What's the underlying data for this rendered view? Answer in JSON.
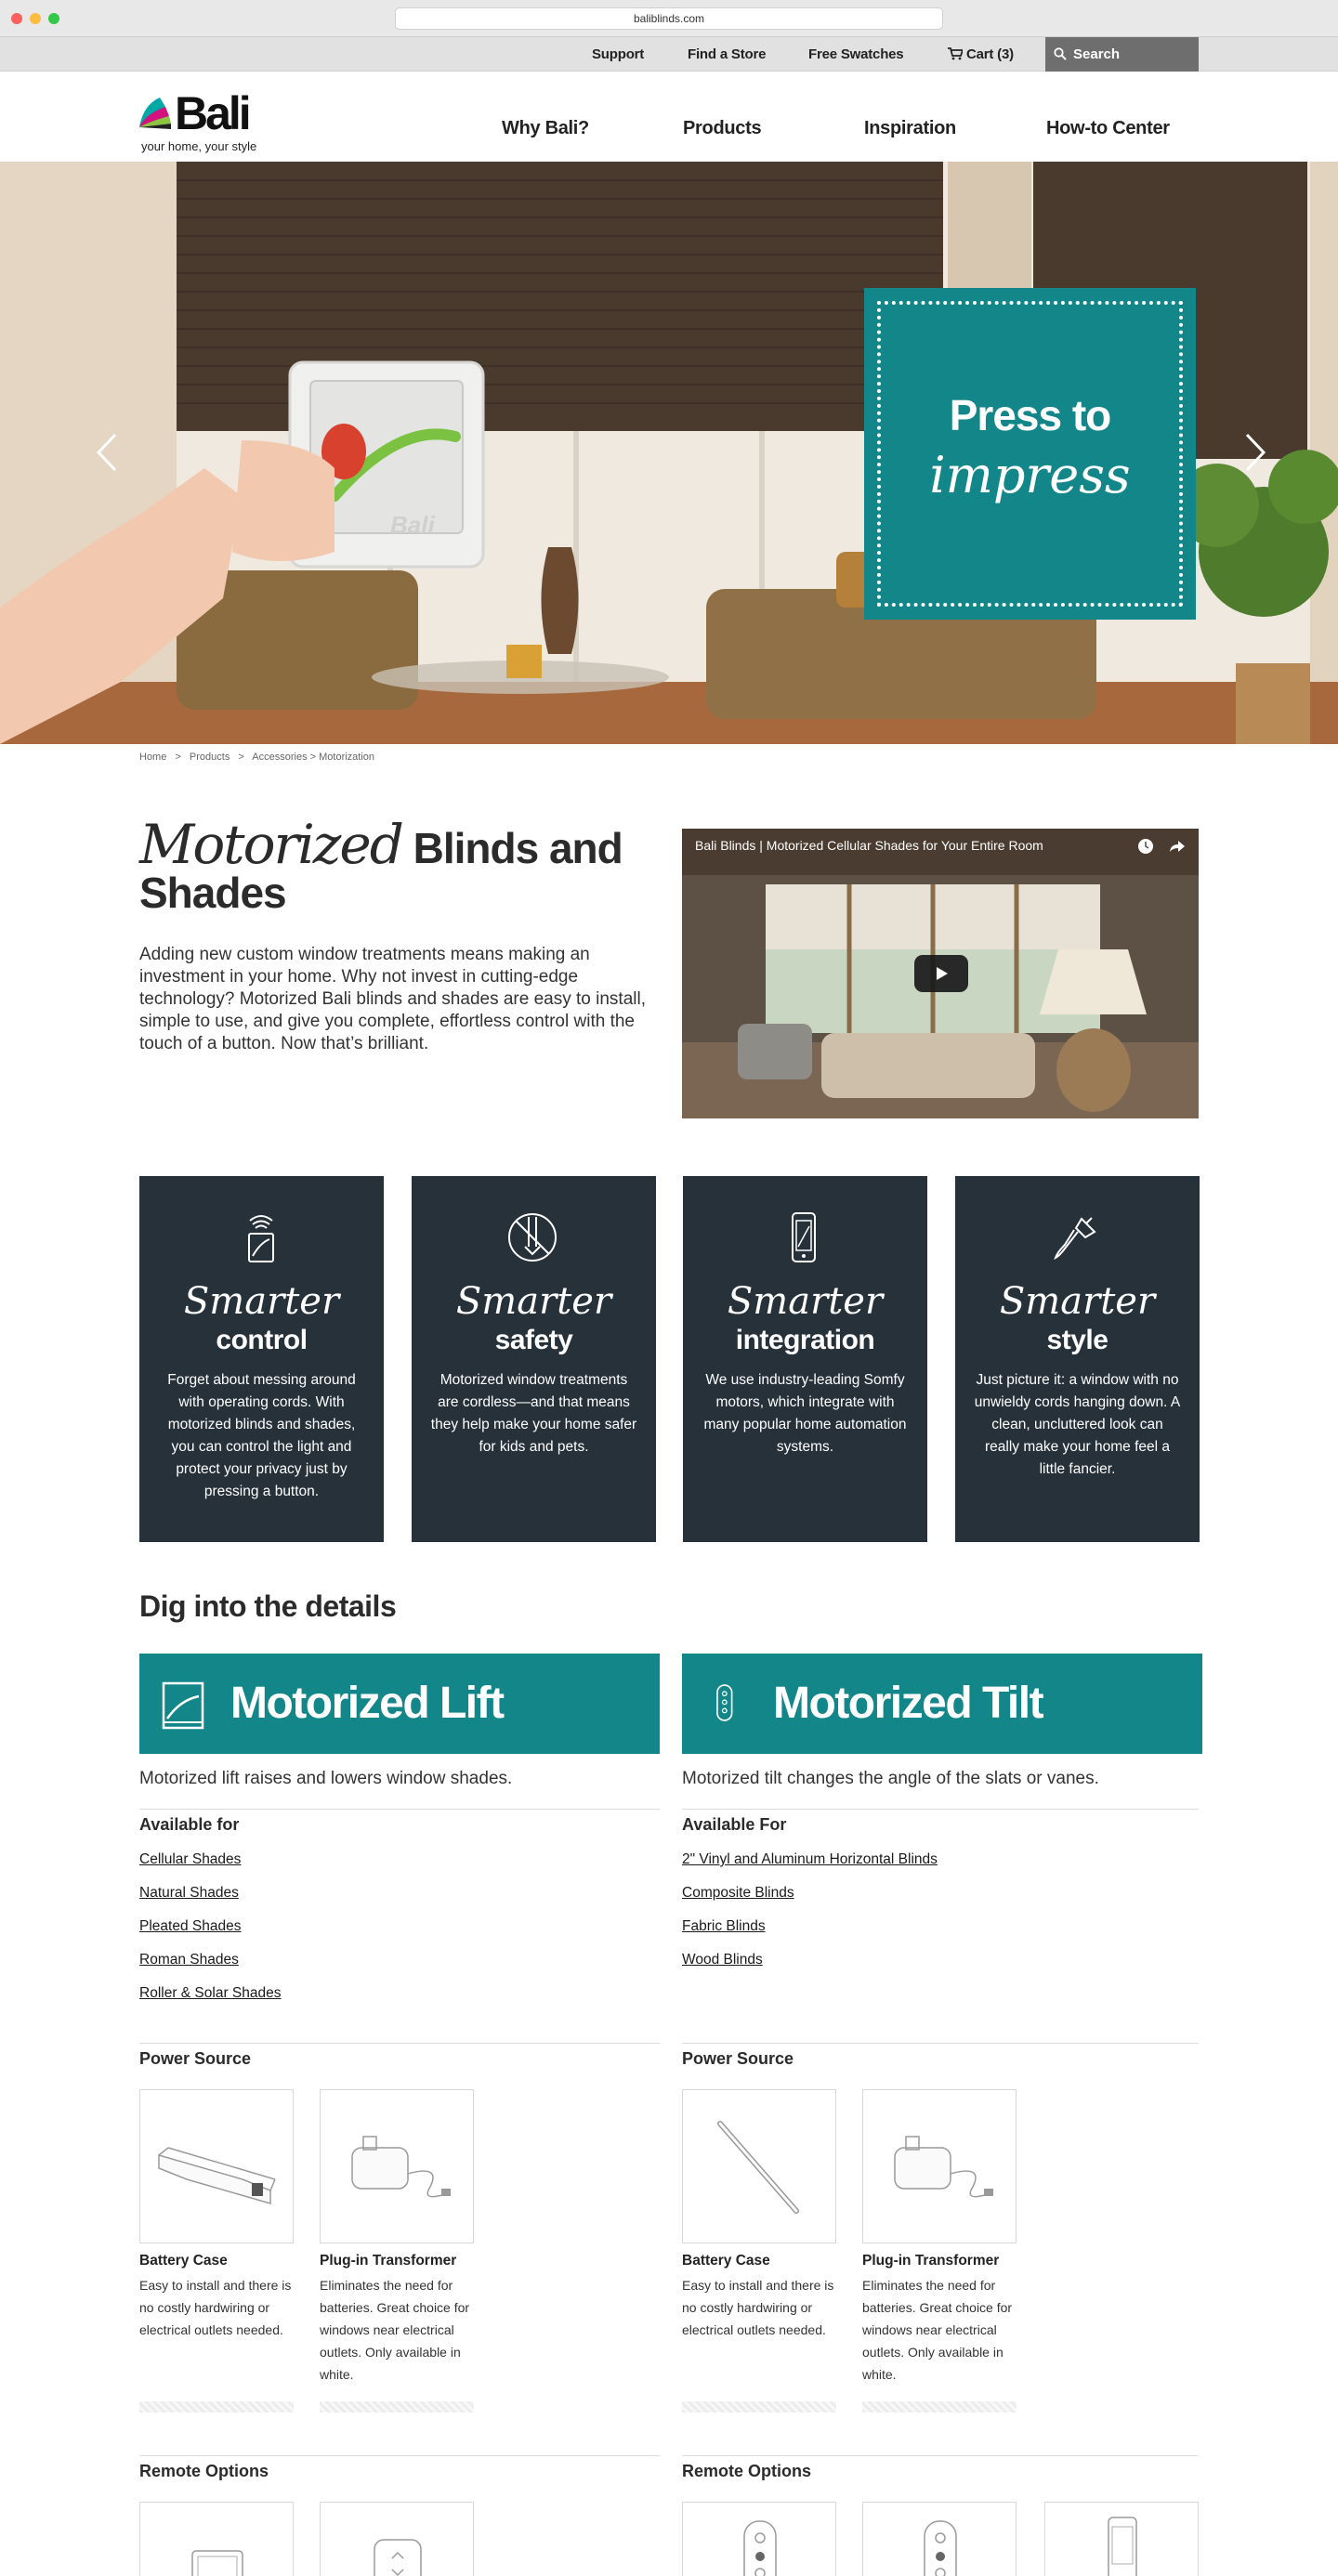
{
  "browser": {
    "url": "baliblinds.com"
  },
  "utility": {
    "support": "Support",
    "find_store": "Find a Store",
    "swatches": "Free Swatches",
    "cart": "Cart (3)",
    "search": "Search"
  },
  "header": {
    "logo_text": "Bali",
    "logo_tagline": "your home, your style",
    "nav": [
      "Why Bali?",
      "Products",
      "Inspiration",
      "How-to Center"
    ]
  },
  "hero": {
    "promo_line1": "Press to",
    "promo_line2": "impress",
    "device_brand": "Bali"
  },
  "breadcrumb": [
    "Home",
    ">",
    "Products",
    ">",
    "Accessories > Motorization"
  ],
  "intro": {
    "title_script": "Motorized",
    "title_rest": "Blinds and Shades",
    "text": "Adding new custom window treatments means making an investment in your home. Why not invest in cutting-edge technology? Motorized Bali blinds and shades are easy to install, simple to use, and give you complete, effortless control with the touch of a button. Now that’s brilliant."
  },
  "video": {
    "title": "Bali Blinds | Motorized Cellular Shades for Your Entire Room"
  },
  "features": [
    {
      "icon": "remote-signal-icon",
      "script": "Smarter",
      "bold": "control",
      "desc": "Forget about messing around with operating cords. With motorized blinds and shades, you can control the light and protect your privacy just by pressing a button."
    },
    {
      "icon": "no-cords-icon",
      "script": "Smarter",
      "bold": "safety",
      "desc": "Motorized window treatments are cordless—and that means they help make your home safer for kids and pets."
    },
    {
      "icon": "smartphone-icon",
      "script": "Smarter",
      "bold": "integration",
      "desc": "We use industry-leading Somfy motors, which integrate with many popular home automation systems."
    },
    {
      "icon": "paintbrush-icon",
      "script": "Smarter",
      "bold": "style",
      "desc": "Just picture it: a window with no unwieldy cords hanging down. A clean, uncluttered look can really make your home feel a little fancier."
    }
  ],
  "details": {
    "title": "Dig into the details",
    "lift": {
      "banner": "Motorized Lift",
      "desc": "Motorized lift raises and lowers window shades.",
      "available_head": "Available for",
      "available": [
        "Cellular Shades",
        "Natural Shades",
        "Pleated Shades",
        "Roman Shades",
        "Roller & Solar Shades"
      ],
      "power_head": "Power Source",
      "power": [
        {
          "name": "Battery Case",
          "desc": "Easy to install and there is no costly hardwiring or electrical outlets needed."
        },
        {
          "name": "Plug-in Transformer",
          "desc": "Eliminates the need for batteries. Great choice for windows near electrical outlets. Only available in white."
        }
      ],
      "remote_head": "Remote Options"
    },
    "tilt": {
      "banner": "Motorized Tilt",
      "desc": "Motorized tilt changes the angle of the slats or vanes.",
      "available_head": "Available For",
      "available": [
        "2\" Vinyl and Aluminum Horizontal Blinds",
        "Composite Blinds",
        "Fabric Blinds",
        "Wood Blinds"
      ],
      "power_head": "Power Source",
      "power": [
        {
          "name": "Battery Case",
          "desc": "Easy to install and there is no costly hardwiring or electrical outlets needed."
        },
        {
          "name": "Plug-in Transformer",
          "desc": "Eliminates the need for batteries. Great choice for windows near electrical outlets. Only available in white."
        }
      ],
      "remote_head": "Remote Options"
    }
  },
  "colors": {
    "teal": "#13868a",
    "dark_card": "#263139",
    "utility_bg": "#e1e1e1"
  }
}
